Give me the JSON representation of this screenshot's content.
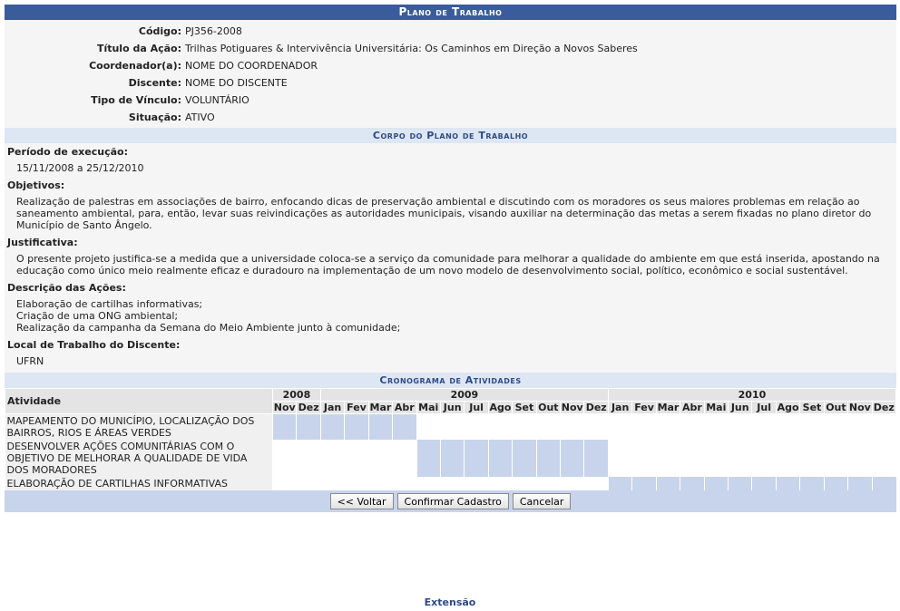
{
  "header": {
    "title": "Plano de Trabalho"
  },
  "info": [
    {
      "label": "Código:",
      "value": "PJ356-2008"
    },
    {
      "label": "Título da Ação:",
      "value": "Trilhas Potiguares & Intervivência Universitária: Os Caminhos em Direção a Novos Saberes"
    },
    {
      "label": "Coordenador(a):",
      "value": "NOME DO COORDENADOR"
    },
    {
      "label": "Discente:",
      "value": "NOME DO DISCENTE"
    },
    {
      "label": "Tipo de Vínculo:",
      "value": "VOLUNTÁRIO"
    },
    {
      "label": "Situação:",
      "value": "ATIVO"
    }
  ],
  "corpo": {
    "title": "Corpo do Plano de Trabalho",
    "sections": [
      {
        "label": "Período de execução:",
        "text": "15/11/2008 a 25/12/2010"
      },
      {
        "label": "Objetivos:",
        "text": "Realização de palestras em associações de bairro, enfocando dicas de preservação ambiental e discutindo com os moradores os seus maiores problemas em relação ao saneamento ambiental, para, então, levar suas reivindicações as autoridades municipais, visando auxiliar na determinação das metas a serem fixadas no plano diretor do Município de Santo Ângelo."
      },
      {
        "label": "Justificativa:",
        "text": "O presente projeto justifica-se a medida que a universidade coloca-se a serviço da comunidade para melhorar a qualidade do ambiente em que está inserida, apostando na educação como único meio realmente eficaz e duradouro na implementação de um novo modelo de desenvolvimento social, político, econômico e social sustentável."
      },
      {
        "label": "Descrição das Ações:",
        "text": "Elaboração de cartilhas informativas;\nCriação de uma ONG ambiental;\nRealização da campanha da Semana do Meio Ambiente junto à comunidade;"
      },
      {
        "label": "Local de Trabalho do Discente:",
        "text": "UFRN"
      }
    ]
  },
  "cronograma": {
    "title": "Cronograma de Atividades",
    "activity_header": "Atividade",
    "years": [
      {
        "year": "2008",
        "months": [
          "Nov",
          "Dez"
        ]
      },
      {
        "year": "2009",
        "months": [
          "Jan",
          "Fev",
          "Mar",
          "Abr",
          "Mai",
          "Jun",
          "Jul",
          "Ago",
          "Set",
          "Out",
          "Nov",
          "Dez"
        ]
      },
      {
        "year": "2010",
        "months": [
          "Jan",
          "Fev",
          "Mar",
          "Abr",
          "Mai",
          "Jun",
          "Jul",
          "Ago",
          "Set",
          "Out",
          "Nov",
          "Dez"
        ]
      }
    ],
    "activities": [
      {
        "name": "MAPEAMENTO DO MUNICÍPIO, LOCALIZAÇÃO DOS BAIRROS, RIOS E ÁREAS VERDES",
        "active_months": [
          0,
          1,
          2,
          3,
          4,
          5
        ]
      },
      {
        "name": "DESENVOLVER AÇÕES COMUNITÁRIAS COM O OBJETIVO DE MELHORAR A QUALIDADE DE VIDA DOS MORADORES",
        "active_months": [
          6,
          7,
          8,
          9,
          10,
          11,
          12,
          13
        ]
      },
      {
        "name": "ELABORAÇÃO DE CARTILHAS INFORMATIVAS",
        "active_months": [
          14,
          15,
          16,
          17,
          18,
          19,
          20,
          21,
          22,
          23,
          24,
          25
        ]
      }
    ]
  },
  "buttons": {
    "back": "<< Voltar",
    "confirm": "Confirmar Cadastro",
    "cancel": "Cancelar"
  },
  "footer": {
    "link": "Extensão"
  },
  "colors": {
    "header_bg": "#3a5c9b",
    "subheader_bg": "#dde6f3",
    "active_cell": "#c8d4ec"
  }
}
